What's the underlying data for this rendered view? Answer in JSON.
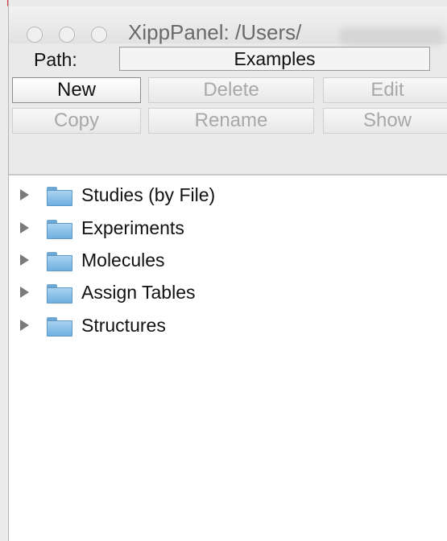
{
  "window": {
    "title": "XippPanel: /Users/"
  },
  "path": {
    "label": "Path:",
    "value": "Examples"
  },
  "buttons": {
    "new": "New",
    "delete": "Delete",
    "edit": "Edit",
    "copy": "Copy",
    "rename": "Rename",
    "show": "Show"
  },
  "tree": {
    "items": [
      {
        "label": "Studies (by File)",
        "icon": "folder-icon",
        "expanded": false
      },
      {
        "label": "Experiments",
        "icon": "folder-icon",
        "expanded": false
      },
      {
        "label": "Molecules",
        "icon": "folder-icon",
        "expanded": false
      },
      {
        "label": "Assign Tables",
        "icon": "folder-icon",
        "expanded": false
      },
      {
        "label": "Structures",
        "icon": "folder-icon",
        "expanded": false
      }
    ]
  },
  "colors": {
    "folder": "#6fb0e0",
    "disabled_text": "#a8a8a8"
  }
}
